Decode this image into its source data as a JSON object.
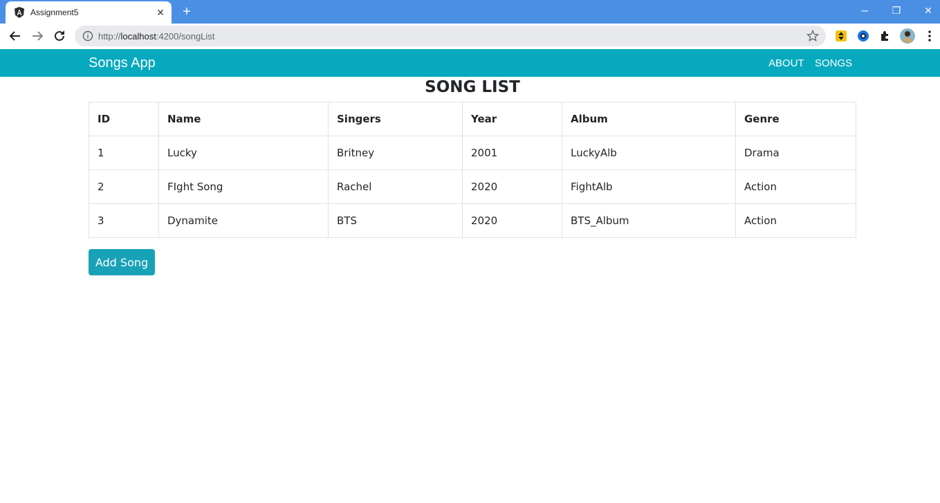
{
  "browser": {
    "tab_title": "Assignment5",
    "url_prefix": "http://",
    "url_host": "localhost",
    "url_rest": ":4200/songList"
  },
  "app": {
    "brand": "Songs App",
    "nav": {
      "about": "ABOUT",
      "songs": "SONGS"
    },
    "accent_color": "#06a9be",
    "button_color": "#17a2b8"
  },
  "page": {
    "title": "SONG LIST",
    "columns": [
      "ID",
      "Name",
      "Singers",
      "Year",
      "Album",
      "Genre"
    ],
    "rows": [
      [
        "1",
        "Lucky",
        "Britney",
        "2001",
        "LuckyAlb",
        "Drama"
      ],
      [
        "2",
        "FIght Song",
        "Rachel",
        "2020",
        "FightAlb",
        "Action"
      ],
      [
        "3",
        "Dynamite",
        "BTS",
        "2020",
        "BTS_Album",
        "Action"
      ]
    ],
    "add_button": "Add Song"
  }
}
